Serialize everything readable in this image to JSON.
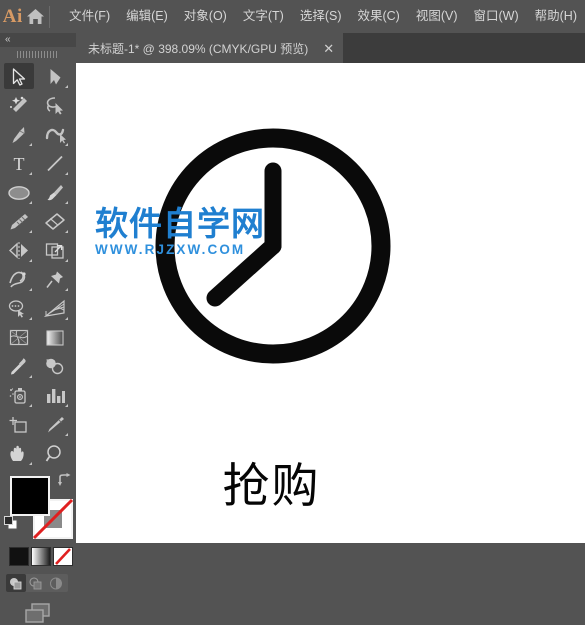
{
  "app": {
    "name": "Ai",
    "logo_color": "#d79a64",
    "chrome_bg": "#535353",
    "tabstrip_bg": "#3c3c3c"
  },
  "menubar": {
    "home_icon": "home-icon",
    "items": [
      {
        "label": "文件(F)",
        "name": "menu-file"
      },
      {
        "label": "编辑(E)",
        "name": "menu-edit"
      },
      {
        "label": "对象(O)",
        "name": "menu-object"
      },
      {
        "label": "文字(T)",
        "name": "menu-type"
      },
      {
        "label": "选择(S)",
        "name": "menu-select"
      },
      {
        "label": "效果(C)",
        "name": "menu-effect"
      },
      {
        "label": "视图(V)",
        "name": "menu-view"
      },
      {
        "label": "窗口(W)",
        "name": "menu-window"
      },
      {
        "label": "帮助(H)",
        "name": "menu-help"
      }
    ]
  },
  "tabbar": {
    "document_title": "未标题-1* @ 398.09% (CMYK/GPU 预览)",
    "close_glyph": "✕"
  },
  "toolpanel": {
    "collapse_glyph": "«",
    "tools": [
      {
        "name": "selection-tool",
        "icon": "arrow-cursor-icon",
        "selected": true,
        "has_flyout": false
      },
      {
        "name": "direct-selection-tool",
        "icon": "direct-select-arrow-icon",
        "selected": false,
        "has_flyout": true
      },
      {
        "name": "magic-wand-tool",
        "icon": "magic-wand-icon",
        "selected": false,
        "has_flyout": false
      },
      {
        "name": "lasso-tool",
        "icon": "lasso-icon",
        "selected": false,
        "has_flyout": false
      },
      {
        "name": "pen-tool",
        "icon": "pen-icon",
        "selected": false,
        "has_flyout": true
      },
      {
        "name": "curvature-tool",
        "icon": "curvature-icon",
        "selected": false,
        "has_flyout": false
      },
      {
        "name": "type-tool",
        "icon": "type-T-icon",
        "selected": false,
        "has_flyout": true
      },
      {
        "name": "line-segment-tool",
        "icon": "line-segment-icon",
        "selected": false,
        "has_flyout": true
      },
      {
        "name": "ellipse-tool",
        "icon": "ellipse-icon",
        "selected": false,
        "has_flyout": true
      },
      {
        "name": "paintbrush-tool",
        "icon": "paintbrush-icon",
        "selected": false,
        "has_flyout": true
      },
      {
        "name": "shaper-tool",
        "icon": "shaper-pencil-icon",
        "selected": false,
        "has_flyout": true
      },
      {
        "name": "eraser-tool",
        "icon": "eraser-icon",
        "selected": false,
        "has_flyout": true
      },
      {
        "name": "reflect-tool",
        "icon": "reflect-icon",
        "selected": false,
        "has_flyout": true
      },
      {
        "name": "scale-tool",
        "icon": "scale-icon",
        "selected": false,
        "has_flyout": true
      },
      {
        "name": "width-tool",
        "icon": "width-warp-icon",
        "selected": false,
        "has_flyout": true
      },
      {
        "name": "free-transform-tool",
        "icon": "pushpin-icon",
        "selected": false,
        "has_flyout": true
      },
      {
        "name": "shape-builder-tool",
        "icon": "shape-builder-icon",
        "selected": false,
        "has_flyout": true
      },
      {
        "name": "perspective-grid-tool",
        "icon": "perspective-grid-icon",
        "selected": false,
        "has_flyout": true
      },
      {
        "name": "mesh-tool",
        "icon": "mesh-icon",
        "selected": false,
        "has_flyout": false
      },
      {
        "name": "gradient-tool",
        "icon": "gradient-swatch-icon",
        "selected": false,
        "has_flyout": false
      },
      {
        "name": "eyedropper-tool",
        "icon": "eyedropper-icon",
        "selected": false,
        "has_flyout": true
      },
      {
        "name": "blend-tool",
        "icon": "blend-icon",
        "selected": false,
        "has_flyout": false
      },
      {
        "name": "symbol-sprayer-tool",
        "icon": "symbol-sprayer-icon",
        "selected": false,
        "has_flyout": true
      },
      {
        "name": "column-graph-tool",
        "icon": "bar-chart-icon",
        "selected": false,
        "has_flyout": true
      },
      {
        "name": "artboard-tool",
        "icon": "artboard-icon",
        "selected": false,
        "has_flyout": false
      },
      {
        "name": "slice-tool",
        "icon": "slice-knife-icon",
        "selected": false,
        "has_flyout": true
      },
      {
        "name": "hand-tool",
        "icon": "hand-icon",
        "selected": false,
        "has_flyout": true
      },
      {
        "name": "zoom-tool",
        "icon": "magnifier-icon",
        "selected": false,
        "has_flyout": false
      }
    ],
    "fill_stroke": {
      "fill_label": "fill-swatch",
      "fill_color": "#000000",
      "stroke_label": "stroke-swatch",
      "stroke_color": "none",
      "swap_icon": "swap-fill-stroke-icon",
      "default_icon": "default-fill-stroke-icon"
    },
    "color_modes": [
      {
        "name": "color-mode-button",
        "icon": "solid-color-icon"
      },
      {
        "name": "gradient-mode-button",
        "icon": "gradient-icon"
      },
      {
        "name": "none-mode-button",
        "icon": "none-slash-icon"
      }
    ],
    "draw_modes": [
      {
        "name": "draw-normal-button",
        "icon": "draw-normal-icon",
        "active": true
      },
      {
        "name": "draw-behind-button",
        "icon": "draw-behind-icon",
        "active": false
      },
      {
        "name": "draw-inside-button",
        "icon": "draw-inside-icon",
        "active": false
      }
    ],
    "screen_mode": {
      "name": "change-screen-mode-button",
      "icon": "screen-mode-icon"
    }
  },
  "canvas": {
    "background": "#ffffff",
    "artwork": {
      "name": "clock-illustration",
      "stroke_color": "#000000",
      "caption": "抢购"
    }
  },
  "watermark": {
    "chinese": "软件自学网",
    "url": "WWW.RJZXW.COM",
    "color": "#1f7fd0"
  }
}
